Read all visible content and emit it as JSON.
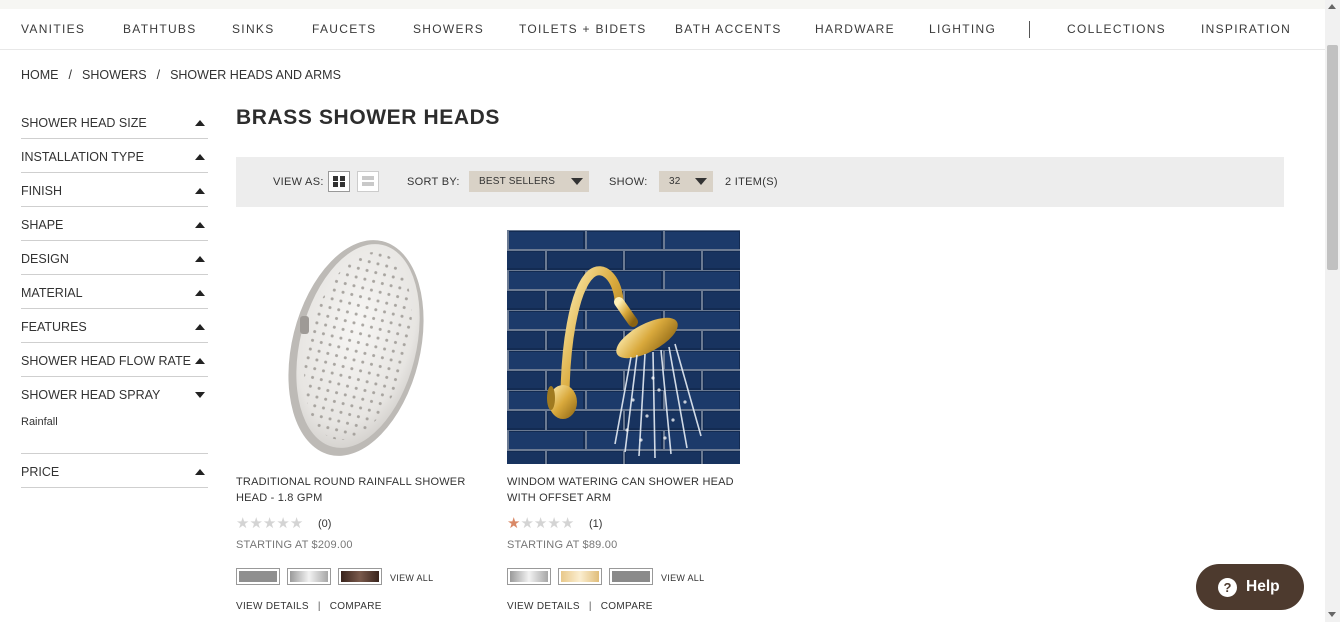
{
  "nav": {
    "items": [
      "VANITIES",
      "BATHTUBS",
      "SINKS",
      "FAUCETS",
      "SHOWERS",
      "TOILETS + BIDETS",
      "BATH ACCENTS",
      "HARDWARE",
      "LIGHTING",
      "COLLECTIONS",
      "INSPIRATION"
    ]
  },
  "breadcrumb": [
    "HOME",
    "SHOWERS",
    "SHOWER HEADS AND ARMS"
  ],
  "breadcrumb_separator": "/",
  "filters": {
    "items": [
      "SHOWER HEAD SIZE",
      "INSTALLATION TYPE",
      "FINISH",
      "SHAPE",
      "DESIGN",
      "MATERIAL",
      "FEATURES",
      "SHOWER HEAD FLOW RATE",
      "SHOWER HEAD SPRAY",
      "PRICE"
    ],
    "spray_option": "Rainfall"
  },
  "page_title": "BRASS SHOWER HEADS",
  "toolbar": {
    "view_as_label": "VIEW AS:",
    "sort_label": "SORT BY:",
    "sort_value": "BEST SELLERS",
    "show_label": "SHOW:",
    "show_value": "32",
    "item_count": "2 ITEM(S)",
    "view_mode": "grid"
  },
  "products": [
    {
      "name": "TRADITIONAL ROUND RAINFALL SHOWER HEAD - 1.8 GPM",
      "rating": 0,
      "max_rating": 5,
      "review_count": "(0)",
      "price": "STARTING AT $209.00",
      "swatch_colors": [
        "#8f8f8f",
        "#c8c8c8",
        "#4a3128"
      ],
      "view_all": "VIEW ALL",
      "view_details": "VIEW DETAILS",
      "compare": "COMPARE"
    },
    {
      "name": "WINDOM WATERING CAN SHOWER HEAD WITH OFFSET ARM",
      "rating": 1,
      "max_rating": 5,
      "review_count": "(1)",
      "price": "STARTING AT $89.00",
      "swatch_colors": [
        "#c8c8c8",
        "#f0d8a0",
        "#8a8a8a"
      ],
      "view_all": "VIEW ALL",
      "view_details": "VIEW DETAILS",
      "compare": "COMPARE"
    }
  ],
  "links_separator": "|",
  "help": {
    "icon": "?",
    "label": "Help"
  },
  "colors": {
    "accent": "#4d3a2e",
    "toolbar_bg": "#ededed",
    "select_bg": "#d9d2c7",
    "star_on": "#d98866",
    "star_off": "#d4d4d4"
  }
}
